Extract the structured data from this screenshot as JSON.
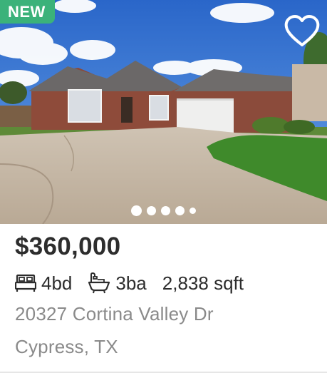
{
  "badge": {
    "label": "NEW"
  },
  "photo": {
    "image_count_dots": 5,
    "active_index": 0
  },
  "listing": {
    "price": "$360,000",
    "beds": "4bd",
    "baths": "3ba",
    "sqft": "2,838 sqft",
    "address_line1": "20327 Cortina Valley Dr",
    "address_line2": "Cypress, TX"
  },
  "icons": {
    "favorite": "heart-outline-icon",
    "beds": "bed-icon",
    "baths": "bathtub-icon"
  },
  "colors": {
    "badge_bg": "#3bb27a",
    "price_text": "#2d2d2d",
    "address_text": "#8a8a8a"
  }
}
